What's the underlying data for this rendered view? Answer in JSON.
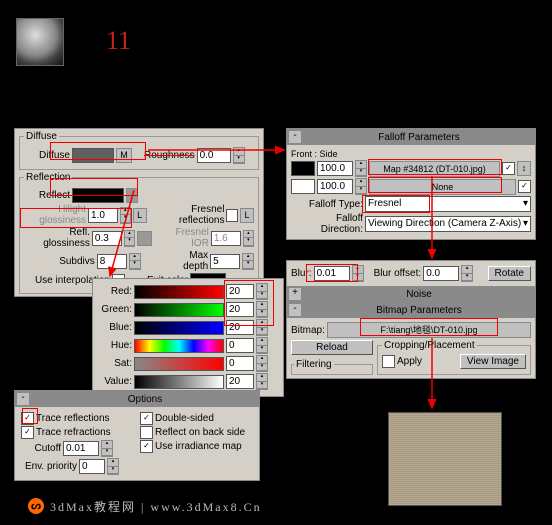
{
  "step_number": "11",
  "diffuse_section": {
    "title": "Diffuse",
    "diffuse_label": "Diffuse",
    "diffuse_color": "#606060",
    "m_button": "M",
    "roughness_label": "Roughness",
    "roughness_value": "0.0"
  },
  "reflection_section": {
    "title": "Reflection",
    "reflect_label": "Reflect",
    "reflect_color": "#000000",
    "hilight_gloss_label": "Hilight glossiness",
    "hilight_gloss_value": "1.0",
    "l_button": "L",
    "fresnel_refl_label": "Fresnel reflections",
    "fresnel_l": "L",
    "refl_gloss_label": "Refl. glossiness",
    "refl_gloss_value": "0.3",
    "fresnel_ior_label": "Fresnel IOR",
    "fresnel_ior_value": "1.6",
    "subdivs_label": "Subdivs",
    "subdivs_value": "8",
    "max_depth_label": "Max depth",
    "max_depth_value": "5",
    "use_interp_label": "Use interpolation",
    "exit_color_label": "Exit color",
    "exit_color": "#000000"
  },
  "color_picker": {
    "red_label": "Red:",
    "red_value": "20",
    "green_label": "Green:",
    "green_value": "20",
    "blue_label": "Blue:",
    "blue_value": "20",
    "hue_label": "Hue:",
    "hue_value": "0",
    "sat_label": "Sat:",
    "sat_value": "0",
    "value_label": "Value:",
    "value_value": "20"
  },
  "options_section": {
    "title": "Options",
    "trace_refl": "Trace reflections",
    "trace_refr": "Trace refractions",
    "cutoff_label": "Cutoff",
    "cutoff_value": "0.01",
    "env_priority_label": "Env. priority",
    "env_priority_value": "0",
    "double_sided": "Double-sided",
    "reflect_back": "Reflect on back side",
    "use_irradiance": "Use irradiance map"
  },
  "falloff_section": {
    "title": "Falloff Parameters",
    "front_side": "Front : Side",
    "slot1_value": "100.0",
    "slot1_color": "#000000",
    "slot1_map": "Map #34812 (DT-010.jpg)",
    "slot2_value": "100.0",
    "slot2_color": "#ffffff",
    "slot2_map": "None",
    "swap_btn": "↕",
    "falloff_type_label": "Falloff Type:",
    "falloff_type_value": "Fresnel",
    "falloff_dir_label": "Falloff Direction:",
    "falloff_dir_value": "Viewing Direction (Camera Z-Axis)"
  },
  "blur_section": {
    "blur_label": "Blur:",
    "blur_value": "0.01",
    "blur_offset_label": "Blur offset:",
    "blur_offset_value": "0.0",
    "rotate_btn": "Rotate"
  },
  "noise_section": {
    "title": "Noise"
  },
  "bitmap_section": {
    "title": "Bitmap Parameters",
    "bitmap_label": "Bitmap:",
    "bitmap_path": "F:\\tiang\\地毯\\DT-010.jpg",
    "reload_btn": "Reload",
    "filtering_title": "Filtering",
    "cropping_title": "Cropping/Placement",
    "apply_label": "Apply",
    "view_image_btn": "View Image"
  },
  "footer": "3dMax教程网 | www.3dMax8.Cn"
}
